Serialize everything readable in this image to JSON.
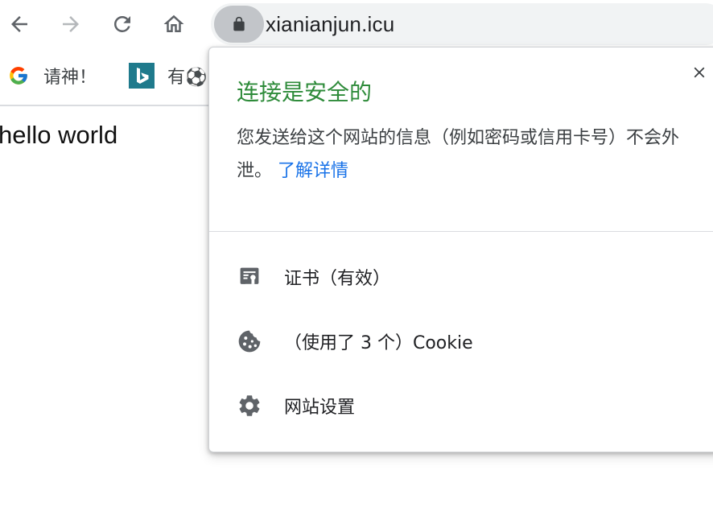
{
  "toolbar": {
    "back_icon": "arrow-left-icon",
    "forward_icon": "arrow-right-icon",
    "reload_icon": "reload-icon",
    "home_icon": "home-icon",
    "lock_icon": "lock-icon",
    "url": "xianianjun.icu"
  },
  "bookmarks": [
    {
      "label": "请神！",
      "icon": "google-icon"
    },
    {
      "label": "有⚽",
      "icon": "bing-icon"
    }
  ],
  "page": {
    "body_text": "hello world"
  },
  "site_info_popup": {
    "title": "连接是安全的",
    "description": "您发送给这个网站的信息（例如密码或信用卡号）不会外泄。",
    "learn_more": "了解详情",
    "close_icon": "close-icon",
    "items": [
      {
        "label": "证书（有效）",
        "icon": "certificate-icon"
      },
      {
        "label": "（使用了 3 个）Cookie",
        "icon": "cookie-icon"
      },
      {
        "label": "网站设置",
        "icon": "gear-icon"
      }
    ]
  },
  "colors": {
    "secure_green": "#2e8b3a",
    "link_blue": "#1a73e8",
    "omnibox_bg": "#f1f3f4",
    "icon_gray": "#5f6368"
  }
}
